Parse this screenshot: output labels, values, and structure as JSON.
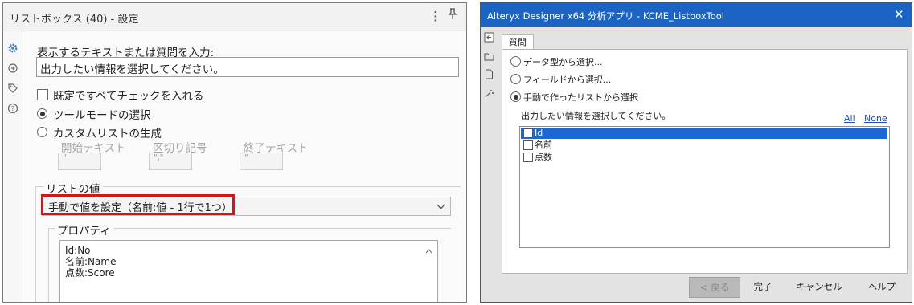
{
  "left_panel": {
    "title": "リストボックス (40) - 設定",
    "kebab_glyph": "⋮",
    "pin_glyph": "⊥",
    "rail_icons": [
      "gear-icon",
      "layers-icon",
      "tag-icon",
      "help-icon"
    ],
    "question_label": "表示するテキストまたは質問を入力:",
    "question_value": "出力したい情報を選択してください。",
    "default_check_label": "既定ですべてチェックを入れる",
    "tool_mode_label": "ツールモードの選択",
    "custom_list_label": "カスタムリストの生成",
    "start_text_label": "開始テキスト",
    "start_text_value": "\"",
    "delimiter_label": "区切り記号",
    "delimiter_value": "\",\"",
    "end_text_label": "終了テキスト",
    "end_text_value": "\"",
    "list_values_label": "リストの値",
    "list_mode_value": "手動で値を設定（名前:値 - 1行で1つ）",
    "properties_label": "プロパティ",
    "properties_lines": [
      "Id:No",
      "名前:Name",
      "点数:Score"
    ]
  },
  "dialog": {
    "title": "Alteryx Designer x64 分析アプリ - KCME_ListboxTool",
    "close_glyph": "✕",
    "tab_label": "質問",
    "option_data_type": "データ型から選択...",
    "option_field": "フィールドから選択...",
    "option_manual": "手動で作ったリストから選択",
    "prompt": "出力したい情報を選択してください。",
    "link_all": "All",
    "link_none": "None",
    "list_items": [
      {
        "label": "Id",
        "checked": false,
        "selected": true
      },
      {
        "label": "名前",
        "checked": false,
        "selected": false
      },
      {
        "label": "点数",
        "checked": false,
        "selected": false
      }
    ],
    "buttons": {
      "back": "< 戻る",
      "finish": "完了",
      "cancel": "キャンセル",
      "help": "ヘルプ"
    }
  },
  "colors": {
    "titlebar": "#1c64c4",
    "selection": "#1e66d2",
    "highlight_border": "#d01818",
    "link": "#1a4fc5"
  }
}
